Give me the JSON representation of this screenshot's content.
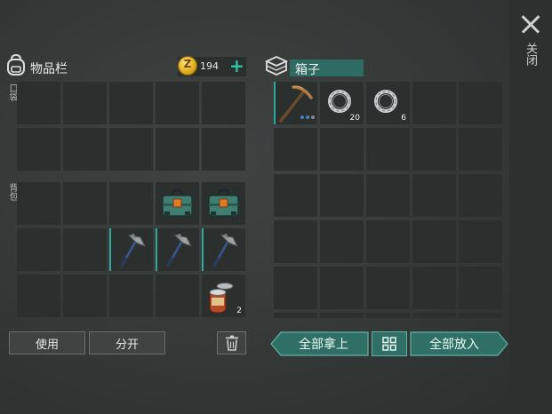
{
  "close_label": "关闭",
  "inventory": {
    "title": "物品栏",
    "coins": "194",
    "coin_symbol": "Z",
    "plus": "+",
    "pocket_label": "口袋",
    "backpack_label": "背包"
  },
  "container": {
    "title": "箱子"
  },
  "pocket_slots": [
    {
      "item": null
    },
    {
      "item": null
    },
    {
      "item": null
    },
    {
      "item": null
    },
    {
      "item": null
    },
    {
      "item": null
    },
    {
      "item": null
    },
    {
      "item": null
    },
    {
      "item": null
    },
    {
      "item": null
    }
  ],
  "backpack_slots": [
    {
      "item": null
    },
    {
      "item": null
    },
    {
      "item": null
    },
    {
      "item": "toolbox-icon",
      "qty": ""
    },
    {
      "item": "toolbox-icon",
      "qty": ""
    },
    {
      "item": null
    },
    {
      "item": null
    },
    {
      "item": "hatchet-icon",
      "qty": "",
      "selected": true
    },
    {
      "item": "hatchet-icon",
      "qty": "",
      "selected": true
    },
    {
      "item": "hatchet-icon",
      "qty": "",
      "selected": true
    },
    {
      "item": null
    },
    {
      "item": null
    },
    {
      "item": null
    },
    {
      "item": null
    },
    {
      "item": "canned-food-icon",
      "qty": "2"
    }
  ],
  "box_slots": [
    {
      "item": "pickaxe-icon",
      "qty": "",
      "selected": true,
      "durability_dots": 3
    },
    {
      "item": "ring-icon",
      "qty": "20"
    },
    {
      "item": "ring-icon",
      "qty": "6"
    },
    {
      "item": null
    },
    {
      "item": null
    },
    {
      "item": null
    },
    {
      "item": null
    },
    {
      "item": null
    },
    {
      "item": null
    },
    {
      "item": null
    },
    {
      "item": null
    },
    {
      "item": null
    },
    {
      "item": null
    },
    {
      "item": null
    },
    {
      "item": null
    },
    {
      "item": null
    },
    {
      "item": null
    },
    {
      "item": null
    },
    {
      "item": null
    },
    {
      "item": null
    },
    {
      "item": null
    },
    {
      "item": null
    },
    {
      "item": null
    },
    {
      "item": null
    },
    {
      "item": null
    },
    {
      "item": null
    },
    {
      "item": null
    },
    {
      "item": null
    },
    {
      "item": null
    },
    {
      "item": null
    }
  ],
  "buttons": {
    "use": "使用",
    "split": "分开",
    "take_all": "全部拿上",
    "put_all": "全部放入"
  },
  "colors": {
    "accent": "#2e6b63",
    "teal_button": "#2f6f66",
    "coin_plus": "#2ec7a4"
  }
}
